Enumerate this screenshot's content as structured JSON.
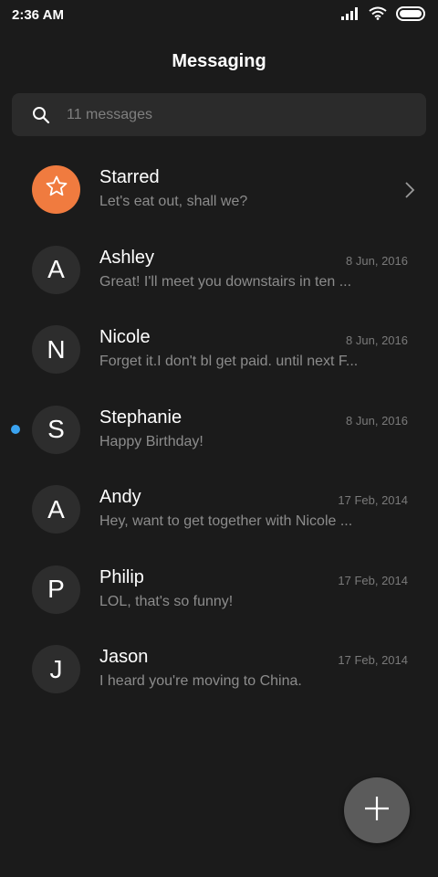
{
  "status_bar": {
    "time": "2:36 AM",
    "icons": [
      "signal-icon",
      "wifi-icon",
      "battery-icon"
    ]
  },
  "header": {
    "title": "Messaging"
  },
  "search": {
    "placeholder": "11 messages",
    "icon": "search-icon"
  },
  "conversations": [
    {
      "name": "Starred",
      "preview": "Let's eat out, shall we?",
      "date": "",
      "avatar": "star-icon",
      "avatar_color": "#f07b3f",
      "chevron": true,
      "unread": false
    },
    {
      "name": "Ashley",
      "preview": "Great! I'll meet you downstairs in ten ...",
      "date": "8 Jun, 2016",
      "avatar": "A",
      "unread": false
    },
    {
      "name": "Nicole",
      "preview": "Forget it.I don't bl get paid. until next F...",
      "date": "8 Jun, 2016",
      "avatar": "N",
      "unread": false
    },
    {
      "name": "Stephanie",
      "preview": "Happy Birthday!",
      "date": "8 Jun, 2016",
      "avatar": "S",
      "unread": true
    },
    {
      "name": "Andy",
      "preview": "Hey, want to get together with Nicole ...",
      "date": "17 Feb, 2014",
      "avatar": "A",
      "unread": false
    },
    {
      "name": "Philip",
      "preview": "LOL, that's so funny!",
      "date": "17 Feb, 2014",
      "avatar": "P",
      "unread": false
    },
    {
      "name": "Jason",
      "preview": "I heard you're moving to China.",
      "date": "17 Feb, 2014",
      "avatar": "J",
      "unread": false
    }
  ],
  "fab": {
    "icon": "plus-icon"
  },
  "colors": {
    "background": "#1b1b1b",
    "search_bg": "#2b2b2b",
    "avatar_bg": "#2d2d2d",
    "accent_orange": "#f07b3f",
    "unread_blue": "#3aa3f0",
    "fab_bg": "#5b5b5b"
  }
}
